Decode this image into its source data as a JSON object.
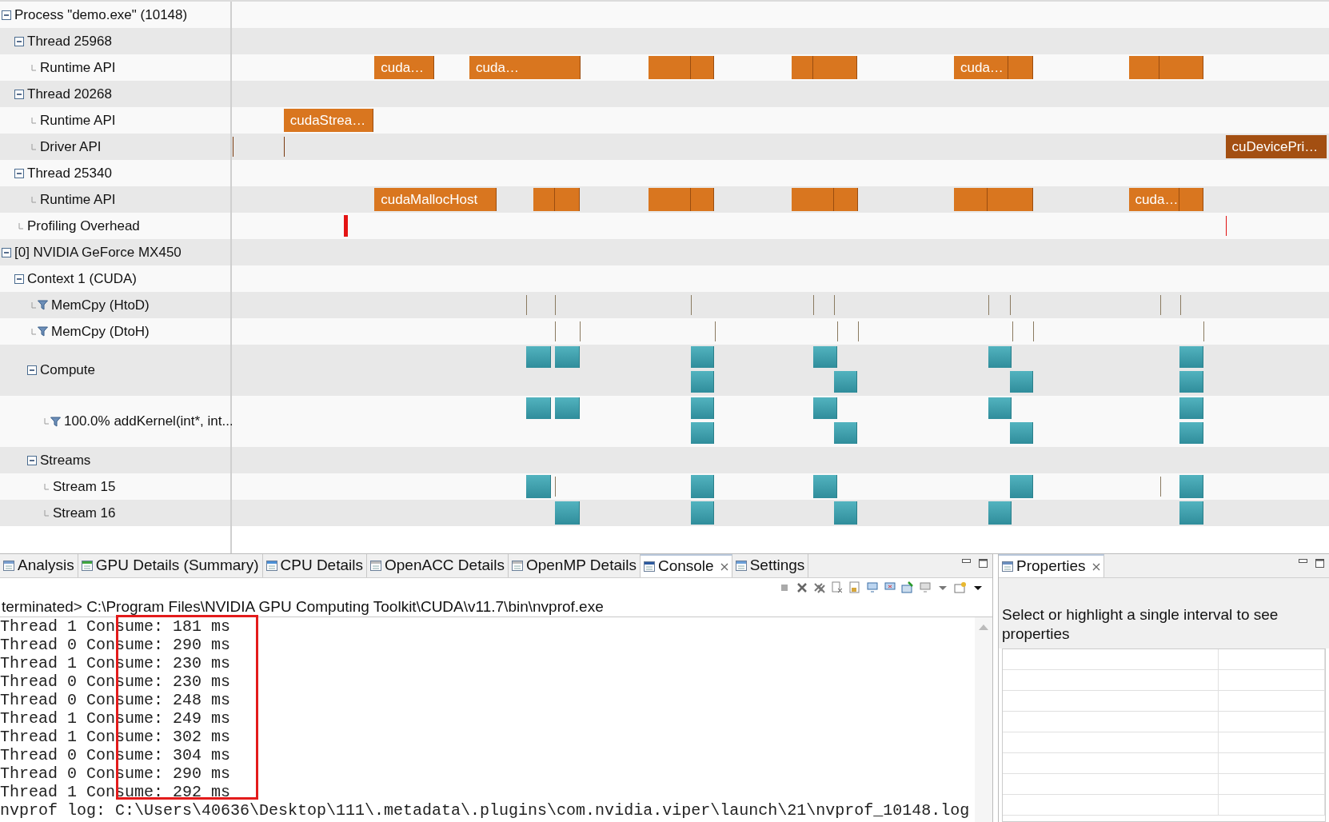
{
  "timeline": {
    "tree": [
      {
        "label": "Process \"demo.exe\" (10148)",
        "expanded": true,
        "children": [
          {
            "label": "Thread 25968",
            "expanded": true,
            "children": [
              {
                "label": "Runtime API",
                "filter": false,
                "bar_labels": [
                  "cuda…",
                  "cuda…",
                  "cuda…"
                ]
              }
            ]
          },
          {
            "label": "Thread 20268",
            "expanded": true,
            "children": [
              {
                "label": "Runtime API",
                "filter": false,
                "bar_labels": [
                  "cudaStrea…"
                ]
              },
              {
                "label": "Driver API",
                "filter": false,
                "bar_labels": [
                  "cuDevicePri…"
                ]
              }
            ]
          },
          {
            "label": "Thread 25340",
            "expanded": true,
            "children": [
              {
                "label": "Runtime API",
                "filter": false,
                "bar_labels": [
                  "cudaMallocHost",
                  "cuda…"
                ]
              }
            ]
          },
          {
            "label": "Profiling Overhead",
            "filter": false
          }
        ]
      },
      {
        "label": "[0] NVIDIA GeForce MX450",
        "expanded": true,
        "children": [
          {
            "label": "Context 1 (CUDA)",
            "expanded": true,
            "children": [
              {
                "label": "MemCpy (HtoD)",
                "filter": true
              },
              {
                "label": "MemCpy (DtoH)",
                "filter": true
              },
              {
                "label": "Compute",
                "expanded": true,
                "children": [
                  {
                    "label": "100.0% addKernel(int*, int...",
                    "filter": true
                  }
                ]
              },
              {
                "label": "Streams",
                "expanded": true,
                "children": [
                  {
                    "label": "Stream 15",
                    "filter": false
                  },
                  {
                    "label": "Stream 16",
                    "filter": false
                  }
                ]
              }
            ]
          }
        ]
      }
    ]
  },
  "console_panel": {
    "tabs": [
      {
        "label": "Analysis",
        "selected": false
      },
      {
        "label": "GPU Details (Summary)",
        "selected": false
      },
      {
        "label": "CPU Details",
        "selected": false
      },
      {
        "label": "OpenACC Details",
        "selected": false
      },
      {
        "label": "OpenMP Details",
        "selected": false
      },
      {
        "label": "Console",
        "selected": true
      },
      {
        "label": "Settings",
        "selected": false
      }
    ],
    "header": "terminated> C:\\Program Files\\NVIDIA GPU Computing Toolkit\\CUDA\\v11.7\\bin\\nvprof.exe",
    "lines": [
      "Thread 1 Consume: 181 ms",
      "Thread 0 Consume: 290 ms",
      "Thread 1 Consume: 230 ms",
      "Thread 0 Consume: 230 ms",
      "Thread 0 Consume: 248 ms",
      "Thread 1 Consume: 249 ms",
      "Thread 1 Consume: 302 ms",
      "Thread 0 Consume: 304 ms",
      "Thread 0 Consume: 290 ms",
      "Thread 1 Consume: 292 ms",
      "nvprof log: C:\\Users\\40636\\Desktop\\111\\.metadata\\.plugins\\com.nvidia.viper\\launch\\21\\nvprof_10148.log"
    ]
  },
  "properties_panel": {
    "tabs": [
      {
        "label": "Properties",
        "selected": true
      }
    ],
    "message": "Select or highlight a single interval to see properties"
  }
}
